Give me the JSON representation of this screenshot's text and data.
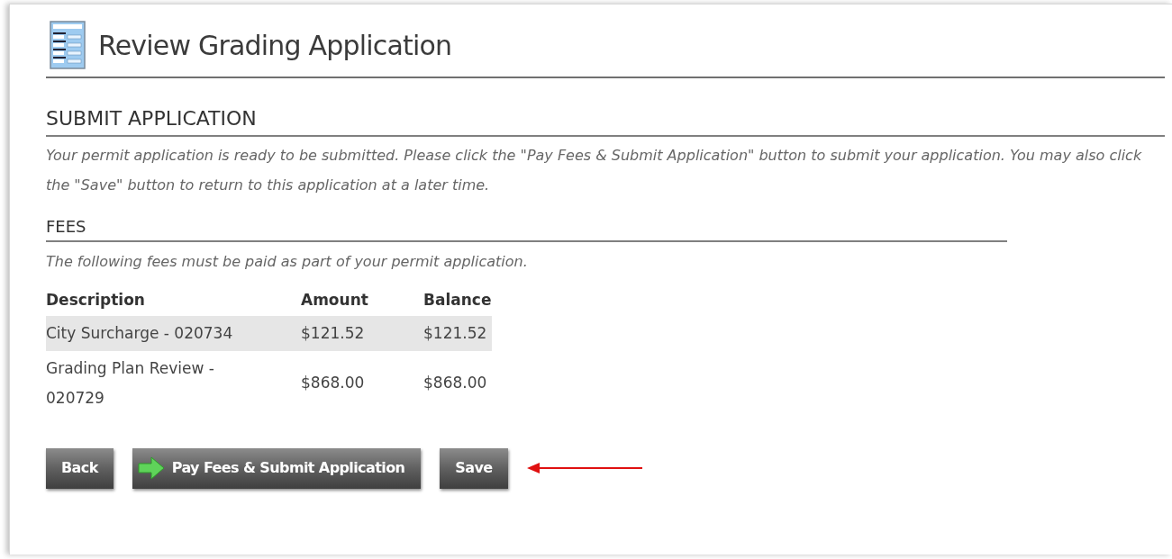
{
  "page": {
    "title": "Review Grading Application"
  },
  "submit_section": {
    "heading": "SUBMIT APPLICATION",
    "message": "Your permit application is ready to be submitted. Please click the \"Pay Fees & Submit Application\" button to submit your application. You may also click the \"Save\" button to return to this application at a later time."
  },
  "fees_section": {
    "heading": "FEES",
    "message": "The following fees must be paid as part of your permit application."
  },
  "fees_table": {
    "columns": [
      "Description",
      "Amount",
      "Balance"
    ],
    "rows": [
      {
        "cells": [
          "City Surcharge - 020734",
          "$121.52",
          "$121.52"
        ],
        "selected": true
      },
      {
        "cells": [
          "Grading Plan Review - 020729",
          "$868.00",
          "$868.00"
        ],
        "selected": false
      }
    ]
  },
  "buttons": [
    {
      "label": "Back",
      "kind": "plain"
    },
    {
      "label": "Pay Fees & Submit Application",
      "kind": "submit"
    },
    {
      "label": "Save",
      "kind": "plain"
    }
  ],
  "annotation": {
    "kind": "arrow"
  }
}
